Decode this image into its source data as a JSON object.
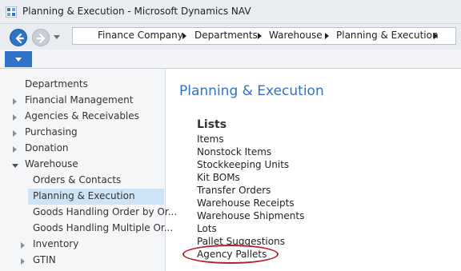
{
  "window": {
    "title": "Planning & Execution - Microsoft Dynamics NAV"
  },
  "address_bar": {
    "crumbs": [
      "Finance Company",
      "Departments",
      "Warehouse",
      "Planning & Execution"
    ]
  },
  "sidebar": {
    "items": [
      {
        "label": "Departments"
      },
      {
        "label": "Financial Management"
      },
      {
        "label": "Agencies & Receivables"
      },
      {
        "label": "Purchasing"
      },
      {
        "label": "Donation"
      },
      {
        "label": "Warehouse"
      },
      {
        "label": "Orders & Contacts"
      },
      {
        "label": "Planning & Execution"
      },
      {
        "label": "Goods Handling Order by Or..."
      },
      {
        "label": "Goods Handling Multiple Or..."
      },
      {
        "label": "Inventory"
      },
      {
        "label": "GTIN"
      }
    ]
  },
  "main": {
    "title": "Planning & Execution",
    "lists_heading": "Lists",
    "links": [
      "Items",
      "Nonstock Items",
      "Stockkeeping Units",
      "Kit BOMs",
      "Transfer Orders",
      "Warehouse Receipts",
      "Warehouse Shipments",
      "Lots",
      "Pallet Suggestions",
      "Agency Pallets"
    ]
  },
  "colors": {
    "accent": "#2e73c8",
    "highlight_circle": "#b2202e",
    "selection": "#cfe3f7"
  }
}
